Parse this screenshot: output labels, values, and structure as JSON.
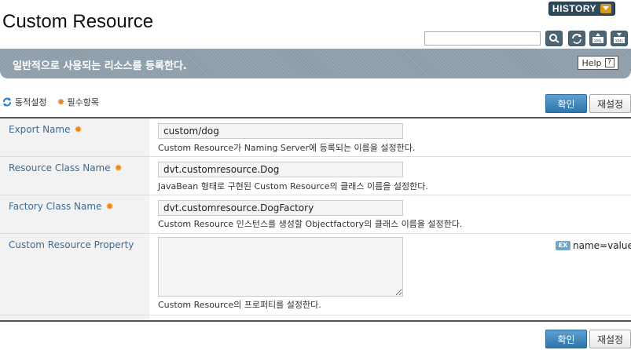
{
  "header": {
    "history_label": "HISTORY",
    "title": "Custom Resource"
  },
  "toolbar": {
    "search_value": "",
    "icons": [
      "search-icon",
      "refresh-icon",
      "xml-export-icon",
      "xml-import-icon"
    ]
  },
  "banner": {
    "text": "일반적으로 사용되는 리소스를 등록한다.",
    "help_label": "Help",
    "help_icon": "?"
  },
  "legend": {
    "dynamic_label": "동적설정",
    "required_label": "필수항목",
    "required_icon": "✹"
  },
  "actions": {
    "ok_label": "확인",
    "reset_label": "재설정"
  },
  "fields": [
    {
      "label": "Export Name",
      "required": true,
      "value": "custom/dog",
      "description": "Custom Resource가 Naming Server에 등록되는 이름을 설정한다."
    },
    {
      "label": "Resource Class Name",
      "required": true,
      "value": "dvt.customresource.Dog",
      "description": "JavaBean 형태로 구현된 Custom Resource의 클래스 이름을 설정한다."
    },
    {
      "label": "Factory Class Name",
      "required": true,
      "value": "dvt.customresource.DogFactory",
      "description": "Custom Resource 인스턴스를 생성할 Objectfactory의 클래스 이름을 설정한다."
    },
    {
      "label": "Custom Resource Property",
      "required": false,
      "value": "",
      "description": "Custom Resource의 프로퍼티를 설정한다.",
      "example_badge": "EX",
      "example_text": "name=value"
    }
  ],
  "colors": {
    "banner": "#8c9ca8",
    "label_text": "#3f6a93",
    "required_star": "#e98b1a",
    "ok_button": "#3a82b8"
  }
}
